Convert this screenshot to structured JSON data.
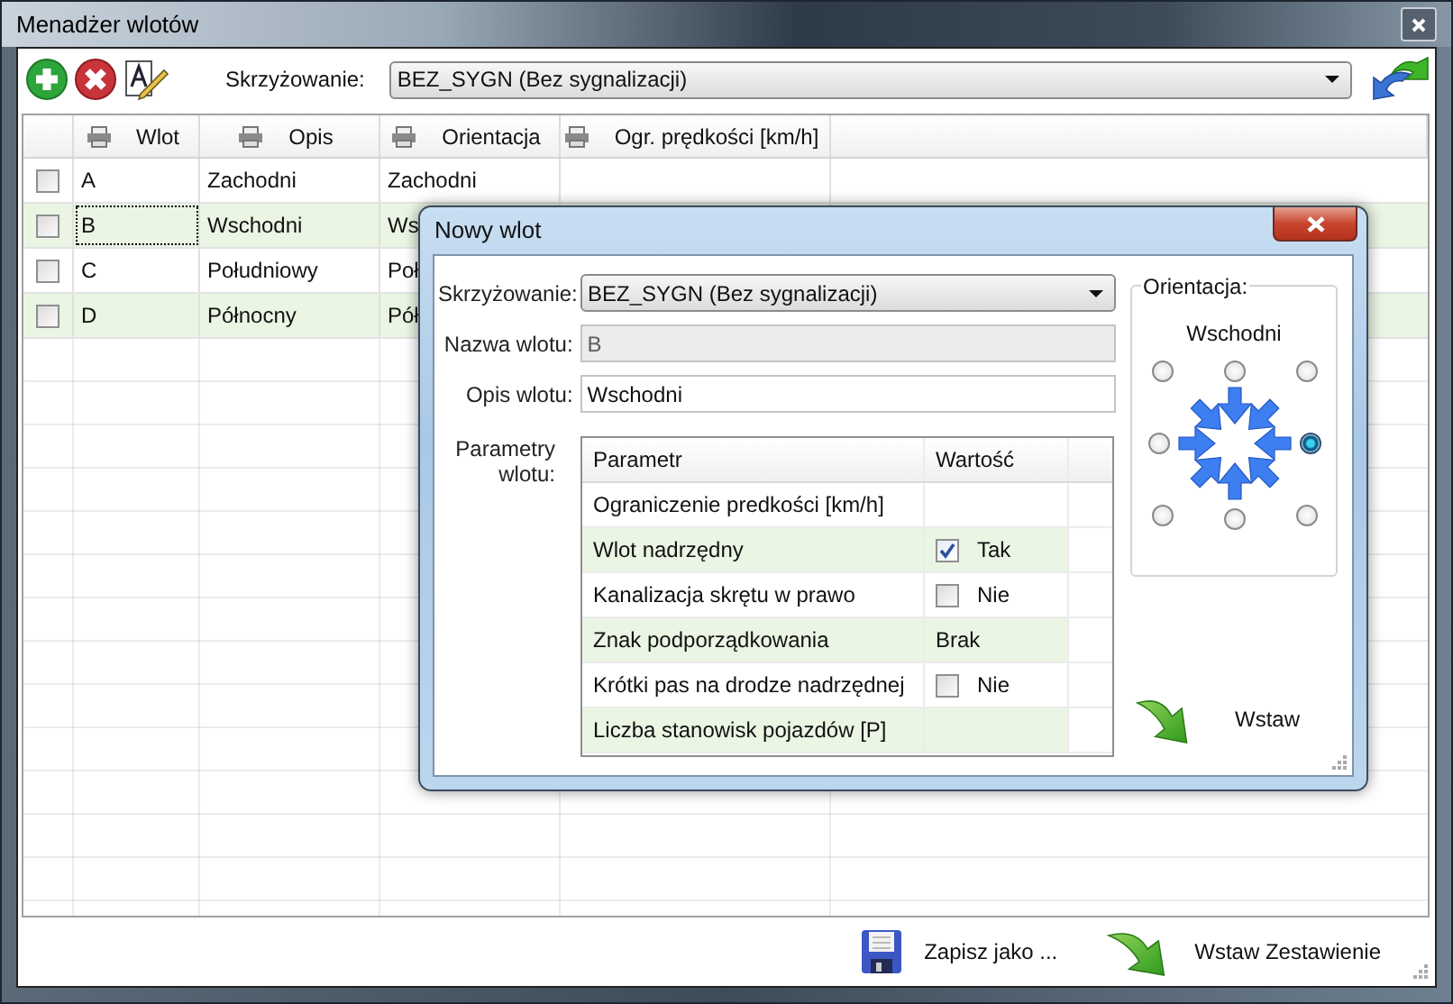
{
  "window": {
    "title": "Menadżer wlotów"
  },
  "toolbar": {
    "label": "Skrzyżowanie:",
    "value": "BEZ_SYGN (Bez sygnalizacji)"
  },
  "table": {
    "columns": [
      "Wlot",
      "Opis",
      "Orientacja",
      "Ogr. prędkości [km/h]"
    ],
    "rows": [
      {
        "checked": false,
        "focused": false,
        "wlot": "A",
        "opis": "Zachodni",
        "orientacja": "Zachodni"
      },
      {
        "checked": false,
        "focused": true,
        "wlot": "B",
        "opis": "Wschodni",
        "orientacja": "Ws"
      },
      {
        "checked": false,
        "focused": false,
        "wlot": "C",
        "opis": "Południowy",
        "orientacja": "Poł"
      },
      {
        "checked": false,
        "focused": false,
        "wlot": "D",
        "opis": "Północny",
        "orientacja": "Pół"
      }
    ]
  },
  "footer_buttons": [
    {
      "kind": "save",
      "label": "Zapisz jako ..."
    },
    {
      "kind": "insert",
      "label": "Wstaw Zestawienie"
    }
  ],
  "dialog": {
    "title": "Nowy wlot",
    "fields": [
      {
        "kind": "dropdown",
        "label": "Skrzyżowanie:",
        "value": "BEZ_SYGN (Bez sygnalizacji)",
        "disabled": false
      },
      {
        "kind": "text",
        "label": "Nazwa wlotu:",
        "value": "B",
        "disabled": true
      },
      {
        "kind": "text",
        "label": "Opis wlotu:",
        "value": "Wschodni",
        "disabled": false
      }
    ],
    "params_label": "Parametry wlotu:",
    "params": {
      "columns": [
        "Parametr",
        "Wartość"
      ],
      "rows": [
        {
          "kind": "text",
          "name": "Ograniczenie predkości [km/h]"
        },
        {
          "kind": "checkbox",
          "name": "Wlot nadrzędny",
          "checked": true,
          "value": "Tak"
        },
        {
          "kind": "checkbox",
          "name": "Kanalizacja skrętu w prawo",
          "checked": false,
          "value": "Nie"
        },
        {
          "kind": "text",
          "name": "Znak podporządkowania",
          "value": "Brak"
        },
        {
          "kind": "checkbox",
          "name": "Krótki pas na drodze nadrzędnej",
          "checked": false,
          "value": "Nie"
        },
        {
          "kind": "text",
          "name": "Liczba stanowisk pojazdów [P]"
        }
      ]
    },
    "orientation": {
      "label": "Orientacja:",
      "value": "Wschodni",
      "options": [
        {
          "selected": false
        },
        {
          "selected": false
        },
        {
          "selected": false
        },
        {
          "selected": false
        },
        {
          "selected": true
        },
        {
          "selected": false
        },
        {
          "selected": false
        },
        {
          "selected": false
        }
      ]
    },
    "insert_button": {
      "label": "Wstaw"
    }
  }
}
